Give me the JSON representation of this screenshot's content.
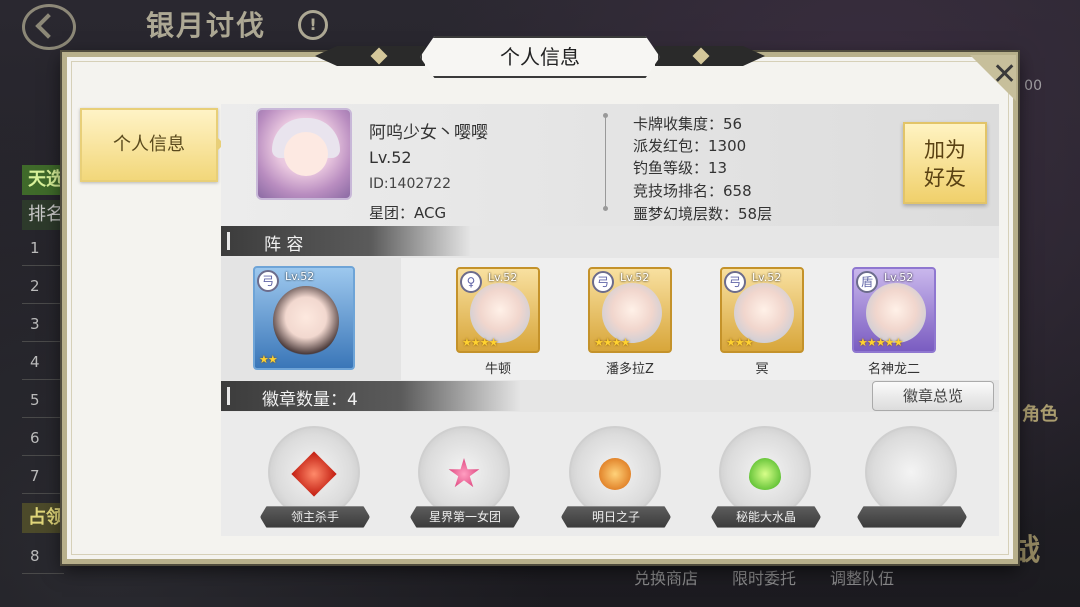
{
  "background": {
    "screen_title": "银月讨伐",
    "help_icon": "!",
    "ranking_header": "天选",
    "ranking_subheader": "排名",
    "ranking_rows": [
      "1",
      "2",
      "3",
      "4",
      "5",
      "6",
      "7"
    ],
    "ranking_header2": "占领",
    "ranking_last_row": "8",
    "bottom_tabs": [
      "兑换商店",
      "限时委托",
      "调整队伍"
    ],
    "right_label": "角色",
    "right_big_text": "战",
    "right_number": "00"
  },
  "dialog": {
    "title": "个人信息",
    "close_label": "✕",
    "side_tab": "个人信息",
    "profile": {
      "name": "阿呜少女丶嘤嘤",
      "level": "Lv.52",
      "id": "ID:1402722",
      "guild": "星团：ACG",
      "stats": [
        "卡牌收集度：56",
        "派发红包：1300",
        "钓鱼等级：13",
        "竞技场排名：658",
        "噩梦幻境层数：58层"
      ],
      "add_friend": "加为\n好友"
    },
    "lineup": {
      "header": "阵 容",
      "leader": {
        "level": "Lv.52",
        "stars": "★★",
        "element": "弓"
      },
      "heroes": [
        {
          "name": "牛顿",
          "level": "Lv.52",
          "stars": "★★★★",
          "element": "♀"
        },
        {
          "name": "潘多拉Z",
          "level": "Lv.52",
          "stars": "★★★★",
          "element": "弓"
        },
        {
          "name": "冥",
          "level": "Lv.52",
          "stars": "★★★",
          "element": "弓"
        },
        {
          "name": "名神龙二",
          "level": "Lv.52",
          "stars": "★★★★★",
          "element": "盾"
        }
      ]
    },
    "badges": {
      "header": "徽章数量：4",
      "browse_button": "徽章总览",
      "items": [
        {
          "name": "领主杀手"
        },
        {
          "name": "星界第一女团"
        },
        {
          "name": "明日之子"
        },
        {
          "name": "秘能大水晶"
        },
        {
          "name": ""
        }
      ]
    }
  }
}
